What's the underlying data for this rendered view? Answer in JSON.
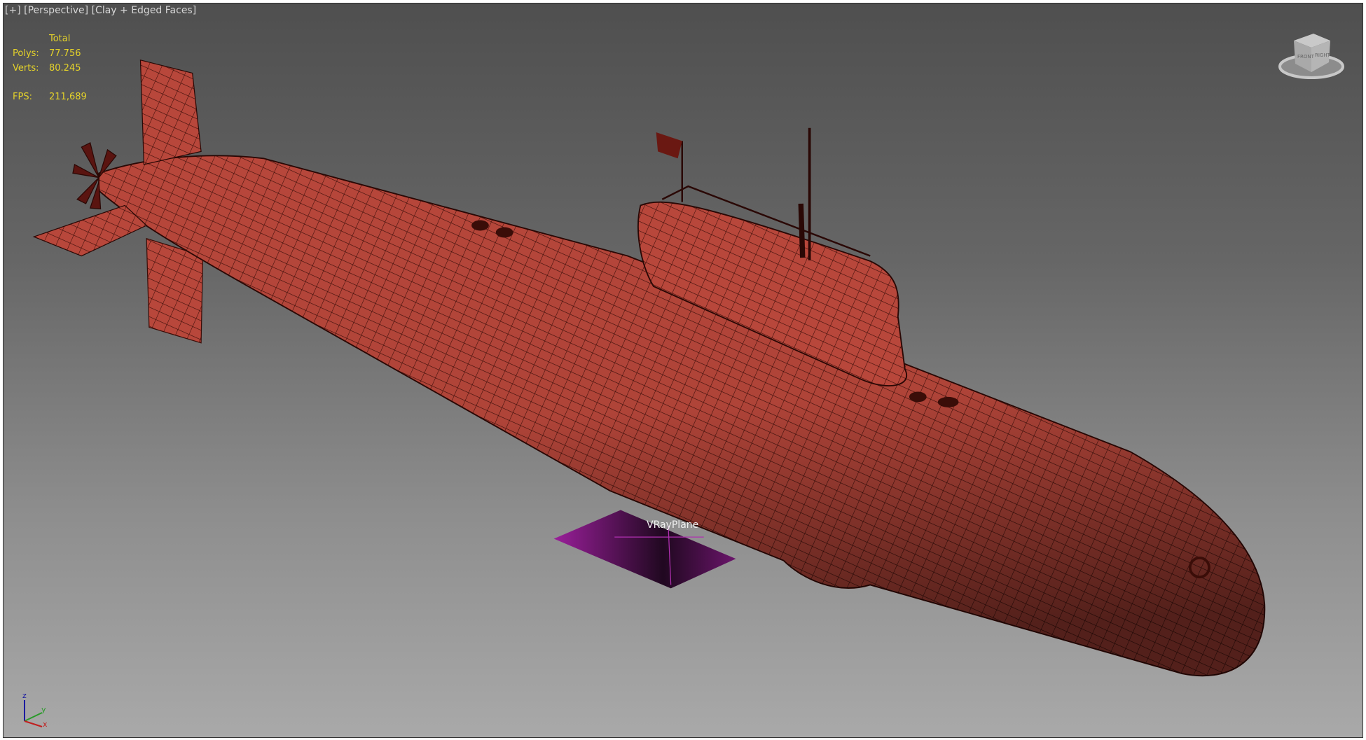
{
  "viewport": {
    "label_plus": "[+]",
    "label_view": "[Perspective]",
    "label_shading": "[Clay + Edged Faces]"
  },
  "stats": {
    "header": "Total",
    "polys_label": "Polys:",
    "polys_value": "77.756",
    "verts_label": "Verts:",
    "verts_value": "80.245",
    "fps_label": "FPS:",
    "fps_value": "211,689"
  },
  "scene": {
    "object_label": "VRayPlane",
    "hull_color": "#b8473b",
    "wire_color": "#3a0d08",
    "plane_color": "#8a1a8a"
  },
  "viewcube": {
    "front": "FRONT",
    "right": "RIGHT"
  },
  "axis": {
    "x": "x",
    "y": "y",
    "z": "z"
  }
}
